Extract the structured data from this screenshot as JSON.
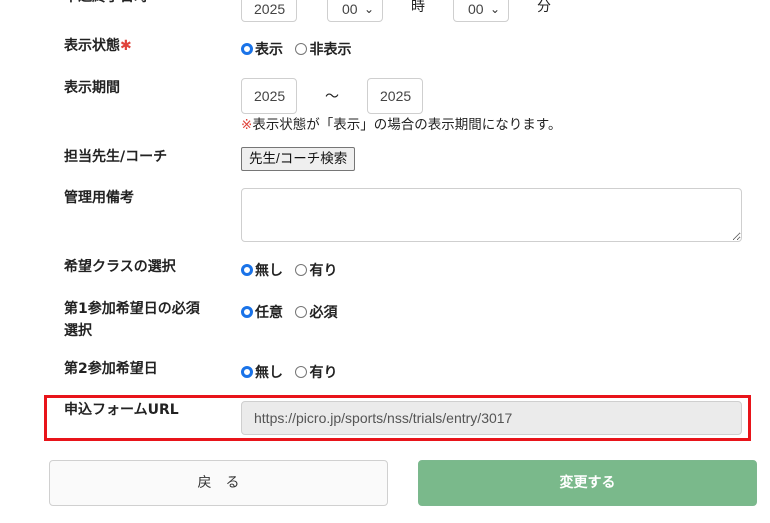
{
  "top_row": {
    "label": "申込終了日時",
    "year": "2025",
    "hour": "00",
    "hour_suffix": "時",
    "minute": "00",
    "minute_suffix": "分"
  },
  "display_status": {
    "label": "表示状態",
    "required_mark": "✱",
    "options": [
      "表示",
      "非表示"
    ],
    "selected": "表示"
  },
  "display_period": {
    "label": "表示期間",
    "from_year": "2025",
    "separator": "〜",
    "to_year": "2025",
    "note_mark": "※",
    "note": "表示状態が「表示」の場合の表示期間になります。"
  },
  "teacher": {
    "label": "担当先生/コーチ",
    "button": "先生/コーチ検索"
  },
  "admin_notes": {
    "label": "管理用備考",
    "value": ""
  },
  "class_selection": {
    "label": "希望クラスの選択",
    "options": [
      "無し",
      "有り"
    ],
    "selected": "無し"
  },
  "first_date_required": {
    "label_line1": "第1参加希望日の必須",
    "label_line2": "選択",
    "options": [
      "任意",
      "必須"
    ],
    "selected": "任意"
  },
  "second_date": {
    "label": "第2参加希望日",
    "options": [
      "無し",
      "有り"
    ],
    "selected": "無し"
  },
  "form_url": {
    "label": "申込フォームURL",
    "value": "https://picro.jp/sports/nss/trials/entry/3017"
  },
  "actions": {
    "back": "戻　る",
    "submit": "変更する"
  },
  "colors": {
    "accent_radio": "#1a73e8",
    "required": "#e0433b",
    "highlight": "#e8141a",
    "submit": "#7ab98b"
  }
}
